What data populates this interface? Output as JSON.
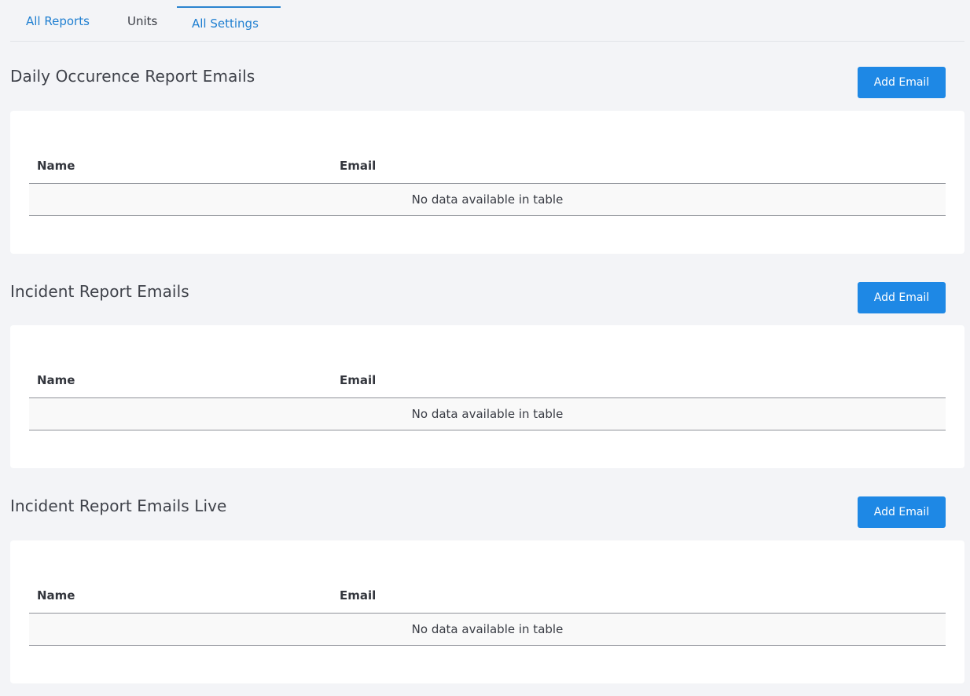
{
  "tabs": [
    {
      "label": "All Reports",
      "style": "link",
      "active": false
    },
    {
      "label": "Units",
      "style": "plain",
      "active": false
    },
    {
      "label": "All Settings",
      "style": "link",
      "active": true
    }
  ],
  "sections": [
    {
      "title": "Daily Occurence Report Emails",
      "add_button": "Add Email",
      "columns": [
        "Name",
        "Email"
      ],
      "empty_message": "No data available in table"
    },
    {
      "title": "Incident Report Emails",
      "add_button": "Add Email",
      "columns": [
        "Name",
        "Email"
      ],
      "empty_message": "No data available in table"
    },
    {
      "title": "Incident Report Emails Live",
      "add_button": "Add Email",
      "columns": [
        "Name",
        "Email"
      ],
      "empty_message": "No data available in table"
    }
  ],
  "colors": {
    "link": "#1f7fd1",
    "button": "#1e88e5",
    "background": "#f3f4f7"
  }
}
